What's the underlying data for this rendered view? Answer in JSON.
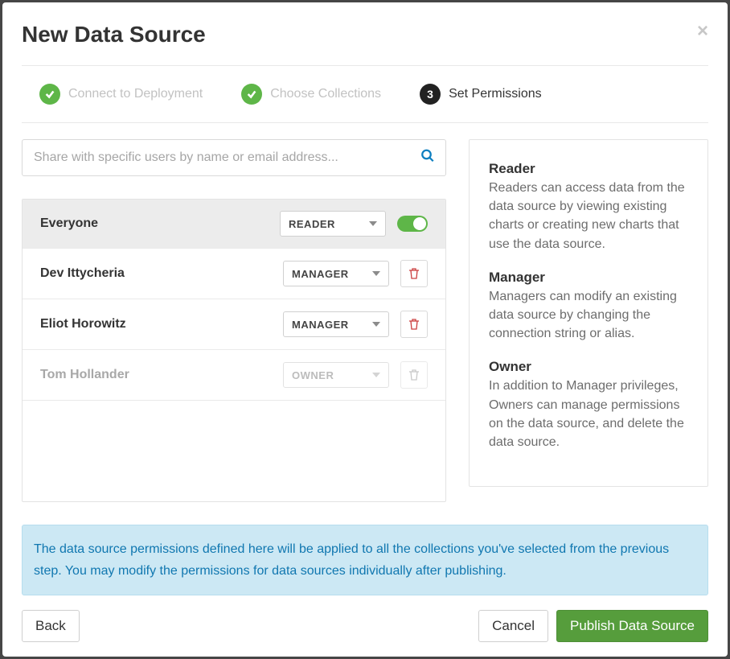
{
  "modal": {
    "title": "New Data Source",
    "close_label": "×"
  },
  "stepper": {
    "step1": "Connect to Deployment",
    "step2": "Choose Collections",
    "step3_num": "3",
    "step3": "Set Permissions"
  },
  "search": {
    "placeholder": "Share with specific users by name or email address..."
  },
  "permissions": [
    {
      "name": "Everyone",
      "role": "READER",
      "everyone": true,
      "toggle": true
    },
    {
      "name": "Dev Ittycheria",
      "role": "MANAGER",
      "deletable": true
    },
    {
      "name": "Eliot Horowitz",
      "role": "MANAGER",
      "deletable": true
    },
    {
      "name": "Tom Hollander",
      "role": "OWNER",
      "disabled": true
    }
  ],
  "roles": {
    "reader_title": "Reader",
    "reader_desc": "Readers can access data from the data source by viewing existing charts or creating new charts that use the data source.",
    "manager_title": "Manager",
    "manager_desc": "Managers can modify an existing data source by changing the connection string or alias.",
    "owner_title": "Owner",
    "owner_desc": "In addition to Manager privileges, Owners can manage permissions on the data source, and delete the data source."
  },
  "info": "The data source permissions defined here will be applied to all the collections you've selected from the previous step. You may modify the permissions for data sources individually after publishing.",
  "footer": {
    "back": "Back",
    "cancel": "Cancel",
    "publish": "Publish Data Source"
  }
}
